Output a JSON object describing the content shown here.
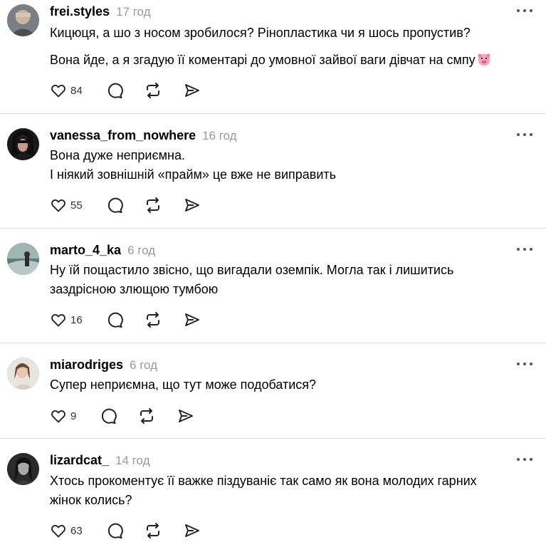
{
  "posts": [
    {
      "username": "frei.styles",
      "time": "17 год",
      "text_lines": [
        "Кицюця, а шо з носом зробилося? Рінопластика чи я шось пропустив?"
      ],
      "text2": "Вона йде, а я згадую її коментарі до умовної зайвої ваги дівчат на смпу",
      "emoji": "pig-face",
      "likes": "84"
    },
    {
      "username": "vanessa_from_nowhere",
      "time": "16 год",
      "text_lines": [
        "Вона дуже неприємна.",
        "І ніякий зовнішній «прайм» це вже не виправить"
      ],
      "likes": "55"
    },
    {
      "username": "marto_4_ka",
      "time": "6 год",
      "text_lines": [
        "Ну їй пощастило звісно, що вигадали оземпік. Могла так і лишитись",
        "заздрісною злющою тумбою"
      ],
      "likes": "16"
    },
    {
      "username": "miarodriges",
      "time": "6 год",
      "text_lines": [
        "Супер неприємна, що тут може подобатися?"
      ],
      "likes": "9"
    },
    {
      "username": "lizardcat_",
      "time": "14 год",
      "text_lines": [
        "Хтось прокоментує її важке піздуваніє так само як вона молодих гарних",
        "жінок колись?"
      ],
      "likes": "63"
    }
  ],
  "icons": {
    "like": "heart-icon",
    "reply": "comment-icon",
    "repost": "repost-icon",
    "share": "send-icon",
    "more": "more-dots-icon"
  }
}
